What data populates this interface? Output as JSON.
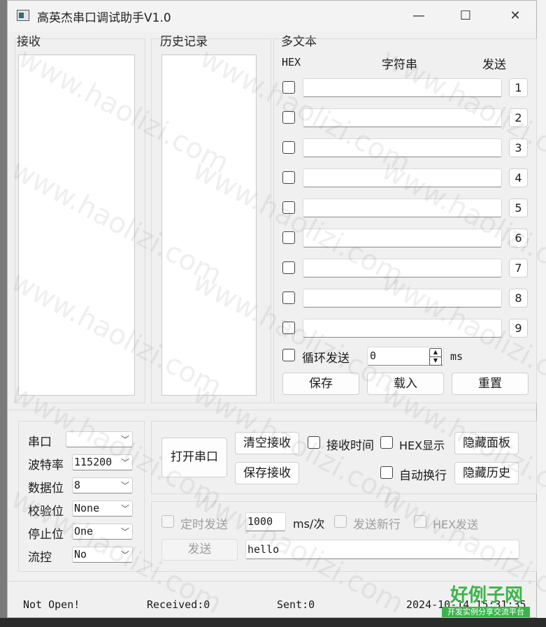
{
  "window": {
    "title": "高英杰串口调试助手V1.0",
    "minimize_glyph": "—",
    "maximize_glyph": "☐",
    "close_glyph": "✕"
  },
  "panels": {
    "receive_label": "接收",
    "history_label": "历史记录",
    "multitext_label": "多文本"
  },
  "multitext": {
    "col_hex": "HEX",
    "col_string": "字符串",
    "col_send": "发送",
    "rows": [
      "1",
      "2",
      "3",
      "4",
      "5",
      "6",
      "7",
      "8",
      "9"
    ],
    "loop_label": "循环发送",
    "loop_value": "0",
    "loop_unit": "ms",
    "save": "保存",
    "load": "载入",
    "reset": "重置"
  },
  "serial": {
    "port_label": "串口",
    "port_value": "",
    "baud_label": "波特率",
    "baud_value": "115200",
    "databits_label": "数据位",
    "databits_value": "8",
    "parity_label": "校验位",
    "parity_value": "None",
    "stopbits_label": "停止位",
    "stopbits_value": "One",
    "flow_label": "流控",
    "flow_value": "No"
  },
  "controls": {
    "open_port": "打开串口",
    "clear_receive": "清空接收",
    "recv_time": "接收时间",
    "hex_display": "HEX显示",
    "hide_panel": "隐藏面板",
    "save_receive": "保存接收",
    "auto_wrap": "自动换行",
    "hide_history": "隐藏历史"
  },
  "send": {
    "timed_send": "定时发送",
    "interval_value": "1000",
    "interval_unit": "ms/次",
    "send_newline": "发送新行",
    "hex_send": "HEX发送",
    "send_button": "发送",
    "send_text": "hello"
  },
  "statusbar": {
    "state": "Not Open!",
    "received": "Received:0",
    "sent": "Sent:0",
    "datetime": "2024-10-14 15:31:35"
  },
  "watermark": {
    "text": "www.haolizi.com",
    "logo_main": "好例子网",
    "logo_sub": "开发实例分享交流平台"
  },
  "colors": {
    "window_bg": "#f0f0f0",
    "logo_green": "#3bb54a"
  }
}
